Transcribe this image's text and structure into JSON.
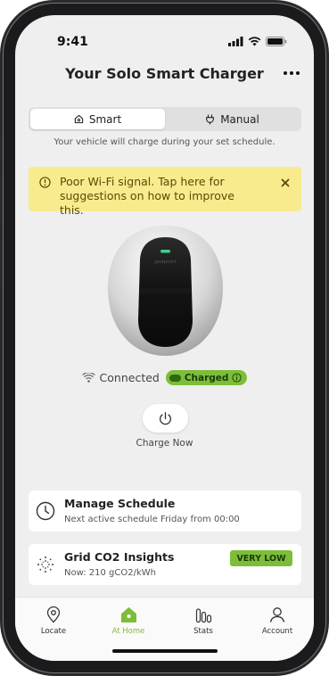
{
  "status_bar": {
    "time": "9:41"
  },
  "header": {
    "title": "Your Solo Smart Charger"
  },
  "mode_toggle": {
    "tabs": [
      {
        "label": "Smart",
        "icon": "home-icon",
        "active": true
      },
      {
        "label": "Manual",
        "icon": "power-plug-icon",
        "active": false
      }
    ],
    "subtitle": "Your vehicle will charge during your set schedule."
  },
  "banner": {
    "text": "Poor Wi-Fi signal. Tap here for suggestions on how to improve this.",
    "icon": "info-icon",
    "color": "#f8eb8e"
  },
  "charger": {
    "brand": "podpoint",
    "led_color": "#3fcf8e"
  },
  "connection": {
    "label": "Connected",
    "badge": "Charged",
    "badge_color": "#7dbd3a"
  },
  "charge_now": {
    "label": "Charge Now",
    "icon": "power-icon"
  },
  "schedule_card": {
    "title": "Manage Schedule",
    "subtitle": "Next active schedule Friday from 00:00",
    "icon": "clock-icon"
  },
  "co2_card": {
    "title": "Grid CO2 Insights",
    "subtitle": "Now: 210 gCO2/kWh",
    "badge": "VERY LOW",
    "icon": "dots-sparkle-icon"
  },
  "tabbar": {
    "items": [
      {
        "label": "Locate",
        "icon": "location-pin-icon",
        "active": false
      },
      {
        "label": "At Home",
        "icon": "house-icon",
        "active": true
      },
      {
        "label": "Stats",
        "icon": "bar-chart-icon",
        "active": false
      },
      {
        "label": "Account",
        "icon": "person-icon",
        "active": false
      }
    ]
  },
  "colors": {
    "accent": "#7dbd3a",
    "background": "#efefef"
  }
}
